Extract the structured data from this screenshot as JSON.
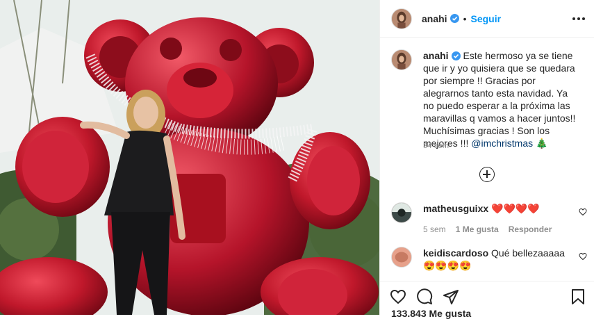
{
  "header": {
    "username": "anahi",
    "separator": "•",
    "follow_label": "Seguir"
  },
  "caption": {
    "username": "anahi",
    "text": "Este hermoso ya se tiene que ir y yo quisiera que se quedara por siempre !! Gracias por alegrarnos tanto esta navidad. Ya no puedo esperar a la próxima las maravillas q vamos a hacer juntos!! Muchísimas gracias ! Son los mejores !!! ",
    "mention": "@imchristmas",
    "emoji": "🎄",
    "age": "34 sem"
  },
  "comments": [
    {
      "username": "matheusguixx",
      "text": "❤️❤️❤️❤️",
      "time": "5 sem",
      "likes": "1 Me gusta",
      "reply_label": "Responder"
    },
    {
      "username": "keidiscardoso",
      "text": "Qué bellezaaaaa😍😍😍😍",
      "time": "",
      "likes": "",
      "reply_label": ""
    }
  ],
  "footer": {
    "likes_count": "133.843 Me gusta"
  },
  "colors": {
    "accent": "#0095f6",
    "verified": "#3897f0",
    "bear": "#c0182b"
  },
  "icons": [
    "more-icon",
    "verified-badge-icon",
    "load-more-icon",
    "heart-icon",
    "comment-icon",
    "share-icon",
    "bookmark-icon"
  ]
}
